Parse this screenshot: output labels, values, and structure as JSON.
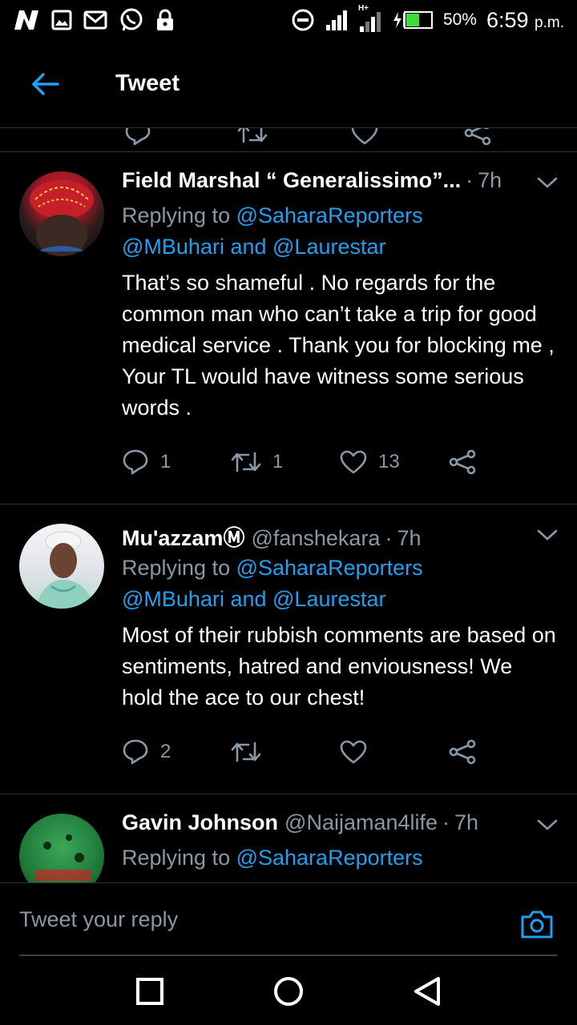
{
  "status_bar": {
    "battery_percent": "50%",
    "time": "6:59",
    "ampm": "p.m.",
    "network_label": "H+"
  },
  "header": {
    "title": "Tweet"
  },
  "tweets": [
    {
      "name": "Field Marshal “ Generalissimo”...",
      "handle": "",
      "time": "7h",
      "replying_prefix": "Replying to ",
      "mention_1": "@SaharaReporters",
      "mention_2": "@MBuhari",
      "mention_join": " and ",
      "mention_3": "@Laurestar",
      "text": "That’s so shameful . No regards for the common man who can’t take a trip for good medical service . Thank you for blocking me , Your TL would have witness some serious words .",
      "replies": "1",
      "retweets": "1",
      "likes": "13"
    },
    {
      "name": "Mu'azzamⓂ",
      "handle": "@fanshekara",
      "time": "7h",
      "replying_prefix": "Replying to ",
      "mention_1": "@SaharaReporters",
      "mention_2": "@MBuhari",
      "mention_join": " and ",
      "mention_3": "@Laurestar",
      "text": "Most of their rubbish comments are based on sentiments, hatred and enviousness! We hold the ace to our chest!",
      "replies": "2",
      "retweets": "",
      "likes": ""
    },
    {
      "name": "Gavin Johnson",
      "handle": "@Naijaman4life",
      "time": "7h",
      "replying_prefix": "Replying to ",
      "mention_1": "@SaharaReporters"
    }
  ],
  "reply_bar": {
    "placeholder": "Tweet your reply"
  },
  "colors": {
    "accent": "#1da1f2",
    "muted": "#8899a6",
    "background": "#000000"
  }
}
